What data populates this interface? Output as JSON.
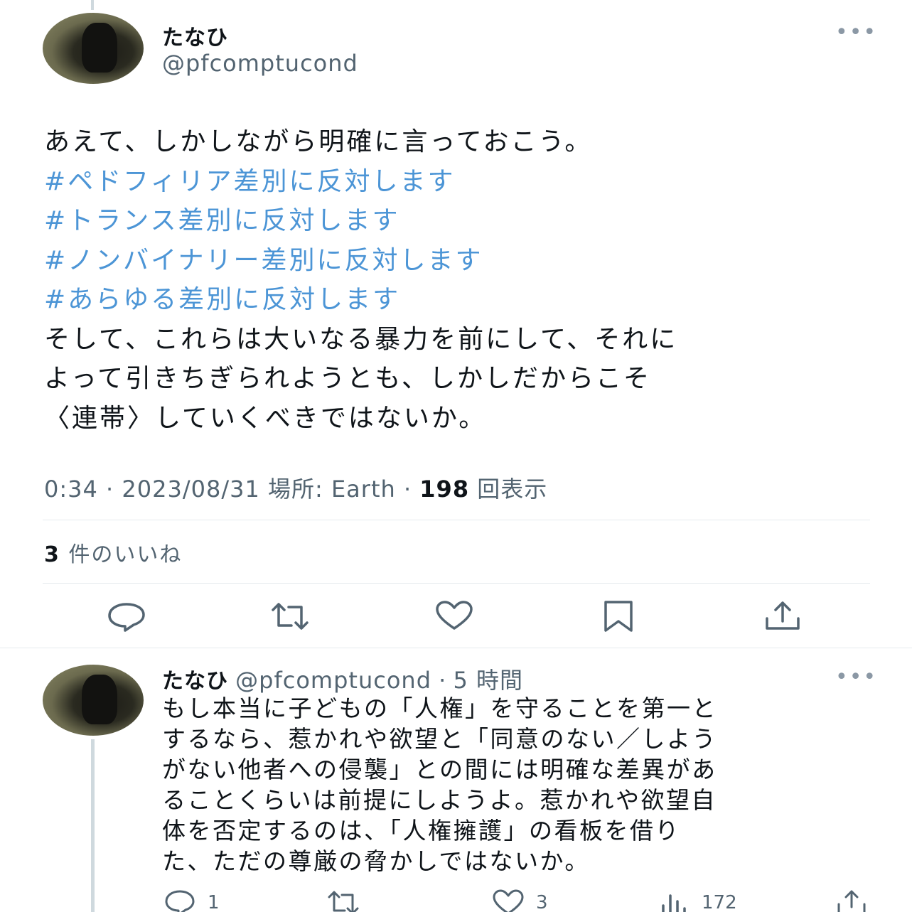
{
  "tweet": {
    "display_name": "たなひ",
    "handle": "@pfcomptucond",
    "more_icon": "more-horizontal-icon",
    "lines": [
      {
        "text": "あえて、しかしながら明確に言っておこう。",
        "hashtag": false
      },
      {
        "text": "#ペドフィリア差別に反対します",
        "hashtag": true
      },
      {
        "text": "#トランス差別に反対します",
        "hashtag": true
      },
      {
        "text": "#ノンバイナリー差別に反対します",
        "hashtag": true
      },
      {
        "text": "#あらゆる差別に反対します",
        "hashtag": true
      },
      {
        "text": "そして、これらは大いなる暴力を前にして、それに",
        "hashtag": false
      },
      {
        "text": "よって引きちぎられようとも、しかしだからこそ",
        "hashtag": false
      },
      {
        "text": "〈連帯〉していくべきではないか。",
        "hashtag": false
      }
    ],
    "meta": {
      "time": "0:34",
      "sep1": " · ",
      "date": "2023/08/31",
      "location_label": " 場所: ",
      "location": "Earth",
      "sep2": " · ",
      "views": "198",
      "views_label": " 回表示"
    },
    "likes": {
      "count": "3",
      "label": " 件のいいね"
    },
    "hashtag_color": "#4c95d6"
  },
  "reply": {
    "display_name": "たなひ",
    "handle": "@pfcomptucond",
    "sep": " · ",
    "time_ago": "5 時間",
    "lines": [
      "もし本当に子どもの「人権」を守ることを第一と",
      "するなら、惹かれや欲望と「同意のない／しよう",
      "がない他者への侵襲」との間には明確な差異があ",
      "ることくらいは前提にしようよ。惹かれや欲望自",
      "体を否定するのは、「人権擁護」の看板を借り",
      "た、ただの尊厳の脅かしではないか。"
    ],
    "actions": {
      "reply_count": "1",
      "retweet_count": "",
      "like_count": "3",
      "views_count": "172"
    }
  }
}
